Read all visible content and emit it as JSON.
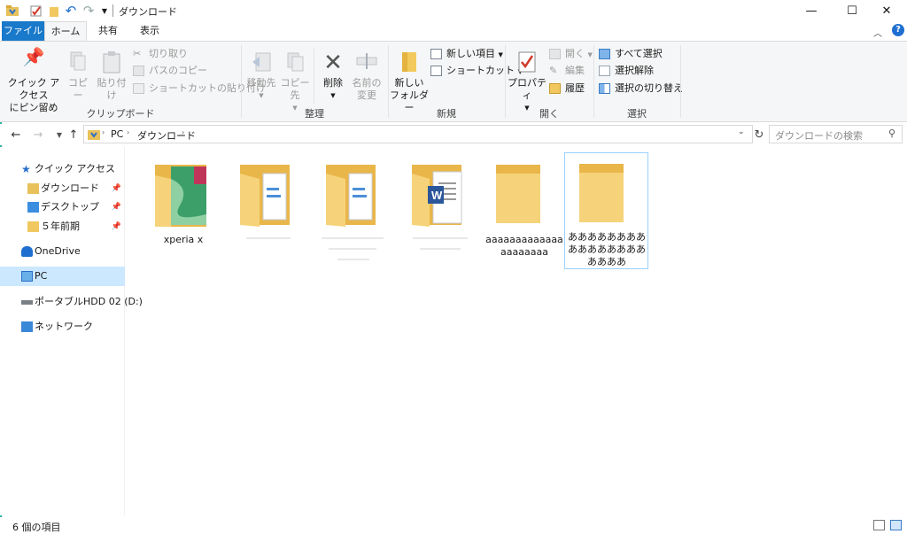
{
  "window": {
    "title": "ダウンロード"
  },
  "controls": {
    "minimize": "—",
    "maximize": "☐",
    "close": "✕"
  },
  "tabs": [
    {
      "label": "ファイル"
    },
    {
      "label": "ホーム"
    },
    {
      "label": "共有"
    },
    {
      "label": "表示"
    }
  ],
  "ribbon": {
    "clipboard": {
      "group": "クリップボード",
      "pin_line1": "クイック アクセス",
      "pin_line2": "にピン留め",
      "copy": "コピー",
      "paste": "貼り付け",
      "cut": "切り取り",
      "copy_path": "パスのコピー",
      "paste_shortcut": "ショートカットの貼り付け"
    },
    "organize": {
      "group": "整理",
      "move_line1": "移動先",
      "copy_to_line1": "コピー先",
      "delete": "削除",
      "rename_line1": "名前の",
      "rename_line2": "変更"
    },
    "new": {
      "group": "新規",
      "new_folder_line1": "新しい",
      "new_folder_line2": "フォルダー",
      "new_item": "新しい項目",
      "shortcut": "ショートカット"
    },
    "open": {
      "group": "開く",
      "properties": "プロパティ",
      "open": "開く",
      "edit": "編集",
      "history": "履歴"
    },
    "select": {
      "group": "選択",
      "select_all": "すべて選択",
      "select_none": "選択解除",
      "invert": "選択の切り替え"
    }
  },
  "address": {
    "pc": "PC",
    "folder": "ダウンロード",
    "search_placeholder": "ダウンロードの検索"
  },
  "nav": {
    "quick_access": "クイック アクセス",
    "downloads": "ダウンロード",
    "desktop": "デスクトップ",
    "five_years": "５年前期",
    "onedrive": "OneDrive",
    "pc": "PC",
    "hdd": "ポータブルHDD 02 (D:)",
    "network": "ネットワーク"
  },
  "files": [
    {
      "name": "xperia x"
    },
    {
      "name": ""
    },
    {
      "name": ""
    },
    {
      "name": ""
    },
    {
      "name": "aaaaaaaaaaaaaaaaaaaaa"
    },
    {
      "name": "ああああああああああああああああああああ"
    }
  ],
  "status": {
    "count": "6 個の項目"
  }
}
